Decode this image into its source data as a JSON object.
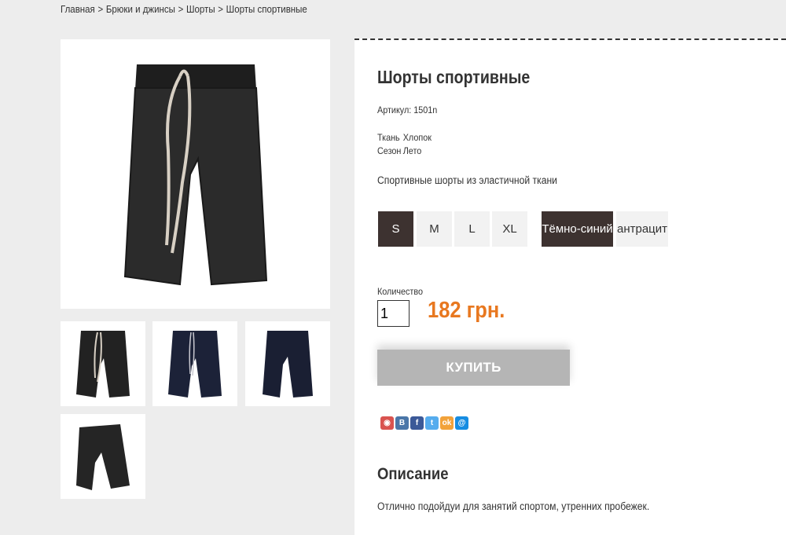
{
  "breadcrumb": [
    {
      "label": "Главная"
    },
    {
      "label": "Брюки и джинсы"
    },
    {
      "label": "Шорты"
    },
    {
      "label": "Шорты спортивные"
    }
  ],
  "breadcrumb_separator": ">",
  "product": {
    "title": "Шорты спортивные",
    "sku_label": "Артикул:",
    "sku_value": "1501n",
    "props": [
      {
        "key": "Ткань",
        "value": "Хлопок"
      },
      {
        "key": "Сезон",
        "value": "Лето"
      }
    ],
    "short_description": "Спортивные шорты из эластичной ткани",
    "sizes": [
      {
        "label": "S",
        "selected": true
      },
      {
        "label": "M",
        "selected": false
      },
      {
        "label": "L",
        "selected": false
      },
      {
        "label": "XL",
        "selected": false
      }
    ],
    "colors": [
      {
        "label": "Тёмно-синий",
        "selected": true
      },
      {
        "label": "антрацит",
        "selected": false
      }
    ],
    "quantity_label": "Количество",
    "quantity_value": "1",
    "price": "182 грн.",
    "buy_label": "КУПИТЬ",
    "description_heading": "Описание",
    "description_text": "Отлично подойдуи для занятий спортом, утренних пробежек."
  },
  "gallery": {
    "main_image": "black-shorts-front-photo",
    "thumbnails": [
      {
        "name": "black-shorts-front-thumb",
        "color": "#222"
      },
      {
        "name": "navy-shorts-front-thumb",
        "color": "#1c2238"
      },
      {
        "name": "navy-shorts-back-thumb",
        "color": "#1a1f33"
      },
      {
        "name": "black-shorts-side-thumb",
        "color": "#252525"
      }
    ]
  },
  "share_icons": [
    {
      "name": "share-icon-1",
      "glyph": "◉",
      "color": "#d9534f"
    },
    {
      "name": "vk-icon",
      "glyph": "В",
      "color": "#4a76a8"
    },
    {
      "name": "facebook-icon",
      "glyph": "f",
      "color": "#3b5998"
    },
    {
      "name": "twitter-icon",
      "glyph": "t",
      "color": "#55acee"
    },
    {
      "name": "odnoklassniki-icon",
      "glyph": "ok",
      "color": "#f2a23a"
    },
    {
      "name": "mail-icon",
      "glyph": "@",
      "color": "#168de2"
    }
  ],
  "colors": {
    "accent": "#e87820",
    "selected_option": "#3d3230",
    "buy_button": "#b5b5b5"
  }
}
